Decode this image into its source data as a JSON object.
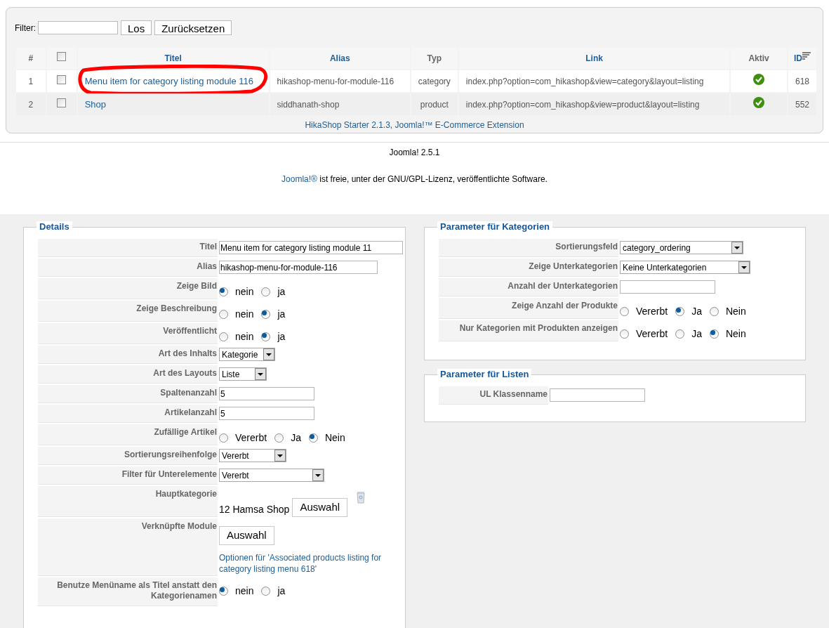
{
  "filter": {
    "label": "Filter:",
    "buttons": [
      "Los",
      "Zurücksetzen"
    ]
  },
  "table": {
    "columns": [
      "#",
      "",
      "Titel",
      "Alias",
      "Typ",
      "Link",
      "Aktiv",
      "ID"
    ],
    "select_all": false,
    "rows": [
      {
        "num": "1",
        "checked": false,
        "title": "Menu item for category listing module 116",
        "alias": "hikashop-menu-for-module-116",
        "type": "category",
        "link": "index.php?option=com_hikashop&view=category&layout=listing",
        "active": true,
        "id": "618",
        "circled": true
      },
      {
        "num": "2",
        "checked": false,
        "title": "Shop",
        "alias": "siddhanath-shop",
        "type": "product",
        "link": "index.php?option=com_hikashop&view=product&layout=listing",
        "active": true,
        "id": "552",
        "circled": false
      }
    ],
    "footer": "HikaShop Starter 2.1.3, Joomla!™ E-Commerce Extension"
  },
  "page_footer": {
    "version": "Joomla! 2.5.1",
    "license": [
      "Joomla!®",
      " ist freie, unter der ",
      "GNU/GPL-Lizenz",
      ", veröffentlichte Software."
    ]
  },
  "details": {
    "title": "Details",
    "fields": [
      {
        "kind": "text",
        "label": "Titel",
        "value": "Menu item for category listing module 11"
      },
      {
        "kind": "text",
        "label": "Alias",
        "value": "hikashop-menu-for-module-116"
      },
      {
        "kind": "radio",
        "label": "Zeige Bild",
        "options": [
          {
            "label": "nein",
            "selected": true
          },
          {
            "label": "ja",
            "selected": false
          }
        ]
      },
      {
        "kind": "radio",
        "label": "Zeige Beschreibung",
        "options": [
          {
            "label": "nein",
            "selected": false
          },
          {
            "label": "ja",
            "selected": true
          }
        ]
      },
      {
        "kind": "radio",
        "label": "Veröffentlicht",
        "options": [
          {
            "label": "nein",
            "selected": false
          },
          {
            "label": "ja",
            "selected": true
          }
        ]
      },
      {
        "kind": "select",
        "label": "Art des Inhalts",
        "value": "Kategorie"
      },
      {
        "kind": "select",
        "label": "Art des Layouts",
        "value": "Liste"
      },
      {
        "kind": "text",
        "label": "Spaltenanzahl",
        "value": "5"
      },
      {
        "kind": "text",
        "label": "Artikelanzahl",
        "value": "5"
      },
      {
        "kind": "radio",
        "label": "Zufällige Artikel",
        "options": [
          {
            "label": "Vererbt",
            "selected": false
          },
          {
            "label": "Ja",
            "selected": false
          },
          {
            "label": "Nein",
            "selected": true
          }
        ]
      },
      {
        "kind": "select",
        "label": "Sortierungsreihenfolge",
        "value": "Vererbt"
      },
      {
        "kind": "select",
        "label": "Filter für Unterelemente",
        "value": "Vererbt"
      },
      {
        "kind": "picker",
        "label": "Hauptkategorie",
        "value": "12 Hamsa Shop",
        "button": "Auswahl"
      },
      {
        "kind": "modules",
        "label": "Verknüpfte Module",
        "button": "Auswahl",
        "link": "Optionen für 'Associated products listing for category listing menu 618'"
      },
      {
        "kind": "radio",
        "label": "Benutze Menüname als Titel anstatt den Kategorienamen",
        "options": [
          {
            "label": "nein",
            "selected": true
          },
          {
            "label": "ja",
            "selected": false
          }
        ]
      }
    ]
  },
  "categories": {
    "title": "Parameter für Kategorien",
    "fields": [
      {
        "kind": "select",
        "label": "Sortierungsfeld",
        "value": "category_ordering"
      },
      {
        "kind": "select",
        "label": "Zeige Unterkategorien",
        "value": "Keine Unterkategorien"
      },
      {
        "kind": "text",
        "label": "Anzahl der Unterkategorien"
      },
      {
        "kind": "radio",
        "label": "Zeige Anzahl der Produkte",
        "options": [
          {
            "label": "Vererbt",
            "selected": false
          },
          {
            "label": "Ja",
            "selected": true
          },
          {
            "label": "Nein",
            "selected": false
          }
        ]
      },
      {
        "kind": "radio",
        "label": "Nur Kategorien mit Produkten anzeigen",
        "options": [
          {
            "label": "Vererbt",
            "selected": false
          },
          {
            "label": "Ja",
            "selected": false
          },
          {
            "label": "Nein",
            "selected": true
          }
        ]
      }
    ]
  },
  "lists": {
    "title": "Parameter für Listen",
    "fields": [
      {
        "kind": "text",
        "label": "UL Klassenname"
      }
    ]
  }
}
